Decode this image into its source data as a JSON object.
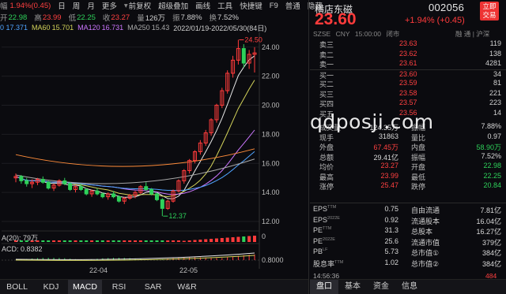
{
  "topbar": {
    "cut_label": "幅",
    "change_pct": "1.94%(0.45)",
    "menu": [
      "日",
      "周",
      "月",
      "更多"
    ],
    "menu2": [
      "前复权",
      "超级叠加",
      "画线",
      "工具",
      "快捷键"
    ],
    "f9": "F9",
    "normal": "普通",
    "last": "隐藏"
  },
  "statbar": {
    "open_label": "开",
    "open": "22.98",
    "high_label": "高",
    "high": "23.99",
    "low_label": "低",
    "low": "22.25",
    "close_label": "收",
    "close": "23.27",
    "vol_label": "量",
    "vol": "126万",
    "amp_label": "振",
    "amp": "7.88%",
    "turn_label": "换",
    "turn": "7.52%"
  },
  "mabar": {
    "ma30": "0 17.371",
    "ma60_label": "MA60",
    "ma60": "15.701",
    "ma120_label": "MA120",
    "ma120": "16.731",
    "ma250_label": "MA250",
    "ma250": "15.43",
    "range": "2022/01/19-2022/05/30(84日)"
  },
  "chart_data": {
    "type": "candlestick",
    "yticks": [
      "24.00",
      "22.00",
      "20.00",
      "18.00",
      "16.00",
      "14.00",
      "12.00"
    ],
    "annotations": {
      "high": "24.50",
      "low": "12.37"
    },
    "xticks": [
      "22-04",
      "22-05"
    ],
    "vol_label": "A(20): 79万",
    "macd_label": "ACD: 0.8382",
    "macd_tick": "0.8000",
    "ylim": [
      12,
      24.8
    ],
    "candles": [
      [
        15.0,
        15.3,
        14.7,
        15.1
      ],
      [
        15.1,
        15.2,
        14.6,
        14.8
      ],
      [
        14.8,
        15.0,
        14.4,
        14.6
      ],
      [
        14.6,
        14.9,
        14.3,
        14.7
      ],
      [
        14.7,
        15.0,
        14.5,
        14.9
      ],
      [
        14.9,
        15.1,
        14.6,
        14.7
      ],
      [
        14.7,
        14.8,
        14.2,
        14.3
      ],
      [
        14.3,
        14.6,
        14.1,
        14.5
      ],
      [
        14.5,
        14.9,
        14.4,
        14.8
      ],
      [
        14.8,
        15.0,
        14.5,
        14.6
      ],
      [
        14.6,
        14.7,
        14.1,
        14.2
      ],
      [
        14.2,
        14.5,
        14.0,
        14.4
      ],
      [
        14.4,
        14.6,
        14.1,
        14.2
      ],
      [
        14.2,
        14.3,
        13.8,
        13.9
      ],
      [
        13.9,
        14.2,
        13.7,
        14.1
      ],
      [
        14.1,
        14.3,
        13.8,
        13.9
      ],
      [
        13.9,
        14.0,
        13.6,
        13.7
      ],
      [
        13.7,
        14.0,
        13.5,
        13.9
      ],
      [
        13.9,
        14.1,
        13.6,
        13.7
      ],
      [
        13.7,
        13.8,
        13.3,
        13.4
      ],
      [
        13.4,
        13.7,
        13.2,
        13.6
      ],
      [
        13.6,
        13.9,
        13.5,
        13.8
      ],
      [
        13.8,
        14.1,
        13.6,
        14.0
      ],
      [
        14.0,
        14.5,
        13.9,
        14.4
      ],
      [
        14.4,
        14.7,
        14.1,
        14.2
      ],
      [
        14.2,
        14.3,
        13.8,
        13.9
      ],
      [
        13.9,
        14.0,
        13.4,
        13.5
      ],
      [
        13.5,
        13.6,
        12.37,
        12.9
      ],
      [
        12.9,
        13.5,
        12.8,
        13.4
      ],
      [
        13.4,
        14.2,
        13.3,
        14.1
      ],
      [
        14.1,
        14.9,
        14.0,
        14.8
      ],
      [
        14.8,
        15.6,
        14.6,
        15.5
      ],
      [
        15.5,
        16.3,
        15.3,
        16.2
      ],
      [
        16.2,
        16.9,
        16.0,
        16.8
      ],
      [
        16.8,
        17.6,
        16.6,
        17.4
      ],
      [
        17.4,
        18.3,
        17.2,
        18.1
      ],
      [
        18.1,
        19.1,
        17.9,
        19.0
      ],
      [
        19.0,
        20.1,
        18.8,
        20.0
      ],
      [
        20.0,
        21.2,
        19.8,
        21.0
      ],
      [
        21.0,
        22.4,
        20.8,
        22.2
      ],
      [
        22.2,
        23.4,
        21.9,
        23.1
      ],
      [
        23.1,
        24.5,
        22.8,
        23.9
      ],
      [
        23.9,
        24.2,
        22.6,
        22.9
      ],
      [
        22.9,
        23.8,
        22.5,
        23.5
      ],
      [
        23.5,
        23.99,
        22.25,
        23.6
      ]
    ]
  },
  "tabs": [
    "BOLL",
    "KDJ",
    "MACD",
    "RSI",
    "SAR",
    "W&R"
  ],
  "active_tab": "MACD",
  "quote": {
    "name": "横店东磁",
    "code": "002056",
    "trade_btn": "立即\n交易",
    "price": "23.60",
    "change": "+1.94% (+0.45)",
    "market": "SZSE",
    "currency": "CNY",
    "time": "15:00:00",
    "status": "闭市",
    "right_meta": "融 通 | 沪深"
  },
  "book": [
    {
      "label": "卖三",
      "price": "23.63",
      "vol": "119"
    },
    {
      "label": "卖二",
      "price": "23.62",
      "vol": "138"
    },
    {
      "label": "卖一",
      "price": "23.61",
      "vol": "4281"
    },
    {
      "label": "买一",
      "price": "23.60",
      "vol": "34"
    },
    {
      "label": "买二",
      "price": "23.59",
      "vol": "81"
    },
    {
      "label": "买三",
      "price": "23.58",
      "vol": "221"
    },
    {
      "label": "买四",
      "price": "23.57",
      "vol": "223"
    },
    {
      "label": "买五",
      "price": "23.56",
      "vol": "14"
    }
  ],
  "stats": [
    {
      "l1": "成交量",
      "v1": "124.35万",
      "l2": "振幅",
      "v2": "7.88%"
    },
    {
      "l1": "现手",
      "v1": "31863",
      "l2": "量比",
      "v2": "0.97"
    },
    {
      "l1": "外盘",
      "v1": "67.45万",
      "l2": "内盘",
      "v2": "58.90万"
    },
    {
      "l1": "总额",
      "v1": "29.41亿",
      "l2": "振幅",
      "v2": "7.52%"
    },
    {
      "l1": "均价",
      "v1": "23.27",
      "l2": "开盘",
      "v2": "22.98"
    },
    {
      "l1": "最高",
      "v1": "23.99",
      "l2": "最低",
      "v2": "22.25"
    },
    {
      "l1": "涨停",
      "v1": "25.47",
      "l2": "跌停",
      "v2": "20.84"
    }
  ],
  "fund": [
    {
      "l1": "EPS",
      "s1": "TTM",
      "v1": "0.75",
      "l2": "自由流通",
      "v2": "7.81亿"
    },
    {
      "l1": "EPS",
      "s1": "2022E",
      "v1": "0.92",
      "l2": "流通股本",
      "v2": "16.04亿"
    },
    {
      "l1": "PE",
      "s1": "TTM",
      "v1": "31.3",
      "l2": "总股本",
      "v2": "16.27亿"
    },
    {
      "l1": "PE",
      "s1": "2022E",
      "v1": "25.6",
      "l2": "流通市值",
      "v2": "379亿"
    },
    {
      "l1": "PB",
      "s1": "LF",
      "v1": "5.73",
      "l2": "总市值①",
      "v2": "384亿"
    },
    {
      "l1": "股息率",
      "s1": "TTM",
      "v1": "1.02",
      "l2": "总市值②",
      "v2": "384亿"
    }
  ],
  "ticker": {
    "time": "14:56:36",
    "vol": "484"
  },
  "right_tabs": [
    "盘口",
    "基本",
    "资金",
    "信息"
  ],
  "right_active": "盘口",
  "watermark": "qdposji.com",
  "colors": {
    "up": "#ff3b3b",
    "down": "#2ed15a",
    "bg": "#0b0b0f"
  }
}
